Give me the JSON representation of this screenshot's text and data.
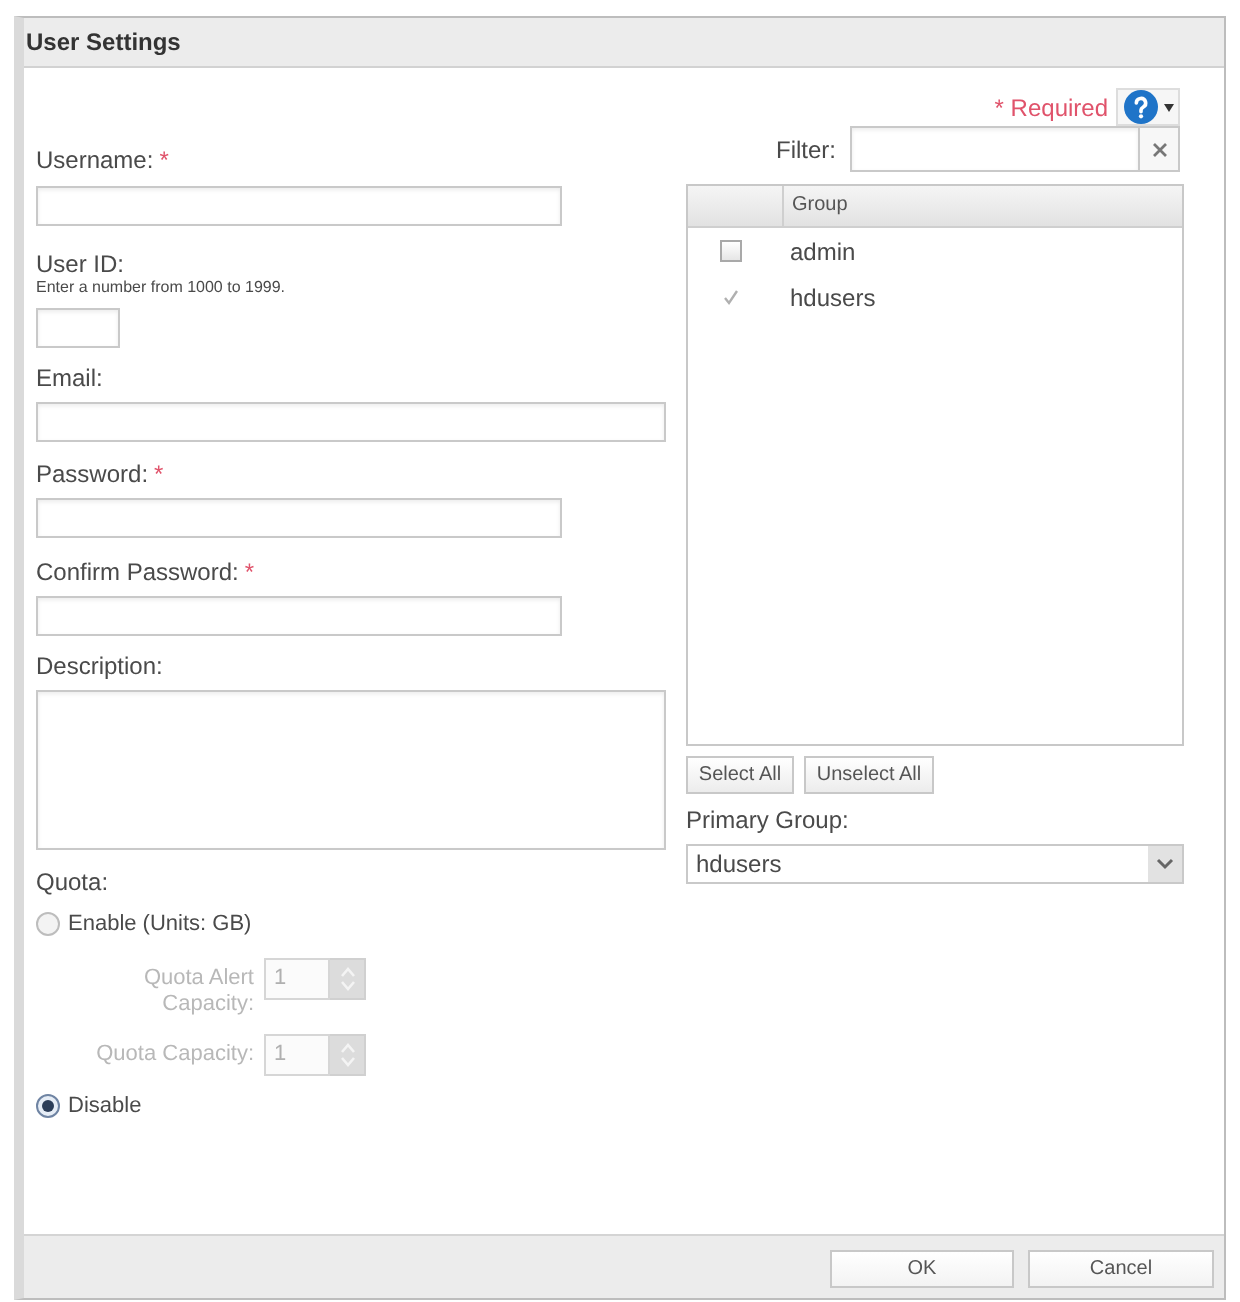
{
  "dialog": {
    "title": "User Settings"
  },
  "required_note": "* Required",
  "form": {
    "username": {
      "label": "Username:",
      "required_mark": "*"
    },
    "user_id": {
      "label": "User ID:",
      "hint": "Enter a number from 1000 to 1999."
    },
    "email": {
      "label": "Email:"
    },
    "password": {
      "label": "Password:",
      "required_mark": "*"
    },
    "confirm_password": {
      "label": "Confirm Password:",
      "required_mark": "*"
    },
    "description": {
      "label": "Description:"
    },
    "quota": {
      "label": "Quota:",
      "options": [
        {
          "label": "Enable (Units: GB)",
          "selected": false
        },
        {
          "label": "Disable",
          "selected": true
        }
      ],
      "alert_capacity": {
        "label": "Quota Alert Capacity:",
        "value": "1",
        "disabled": true
      },
      "capacity": {
        "label": "Quota Capacity:",
        "value": "1",
        "disabled": true
      }
    }
  },
  "groups": {
    "filter": {
      "label": "Filter:"
    },
    "columns": [
      "Group"
    ],
    "rows": [
      {
        "name": "admin",
        "checked": false
      },
      {
        "name": "hdusers",
        "checked": true
      }
    ],
    "buttons": [
      "Select All",
      "Unselect All"
    ],
    "primary_group": {
      "label": "Primary Group:",
      "value": "hdusers"
    }
  },
  "footer": {
    "buttons": [
      "OK",
      "Cancel"
    ]
  }
}
